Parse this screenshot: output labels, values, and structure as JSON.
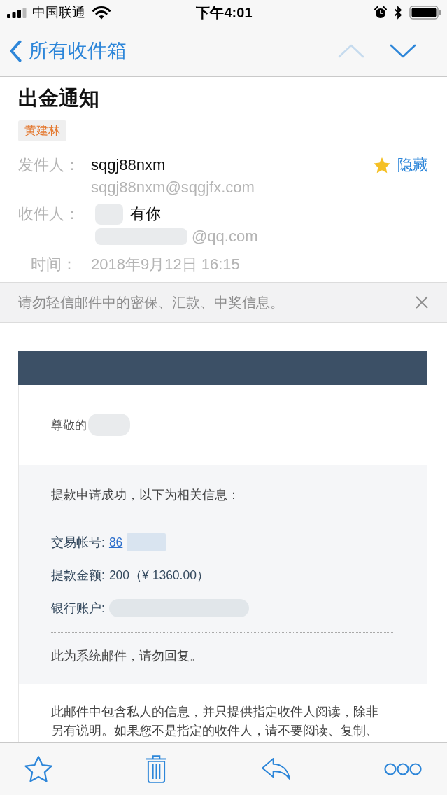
{
  "status_bar": {
    "carrier": "中国联通",
    "time": "下午4:01"
  },
  "nav_bar": {
    "back_label": "所有收件箱",
    "arrows": [
      {
        "kind": "up",
        "disabled": true
      },
      {
        "kind": "down",
        "disabled": false
      }
    ]
  },
  "message": {
    "subject": "出金通知",
    "tag": "黄建林",
    "sender": {
      "label": "发件人：",
      "name": "sqgj88nxm",
      "email": "sqgj88nxm@sqgjfx.com",
      "hide_label": "隐藏"
    },
    "recipient": {
      "label": "收件人：",
      "name": "有你",
      "email": "@qq.com",
      "redacted": true
    },
    "time": {
      "label": "时间：",
      "value": "2018年9月12日 16:15"
    }
  },
  "warning_bar": {
    "text": "请勿轻信邮件中的密保、汇款、中奖信息。"
  },
  "email_body": {
    "greeting": {
      "text": "尊敬的",
      "redacted": true
    },
    "intro": "提款申请成功，以下为相关信息：",
    "fields": [
      {
        "kind": "link",
        "label": "交易帐号:",
        "value": "86",
        "redacted": true
      },
      {
        "kind": "text",
        "label": "提款金额:",
        "value": "200（¥ 1360.00）"
      },
      {
        "kind": "text",
        "label": "银行账户:",
        "redacted": true
      }
    ],
    "notice": "此为系统邮件，请勿回复。",
    "disclaimer": "此邮件中包含私人的信息，并只提供指定收件人阅读，除非另有说明。如果您不是指定的收件人，请不要阅读、复制、"
  },
  "toolbar": [
    {
      "kind": "star"
    },
    {
      "kind": "trash"
    },
    {
      "kind": "reply"
    },
    {
      "kind": "more"
    }
  ]
}
